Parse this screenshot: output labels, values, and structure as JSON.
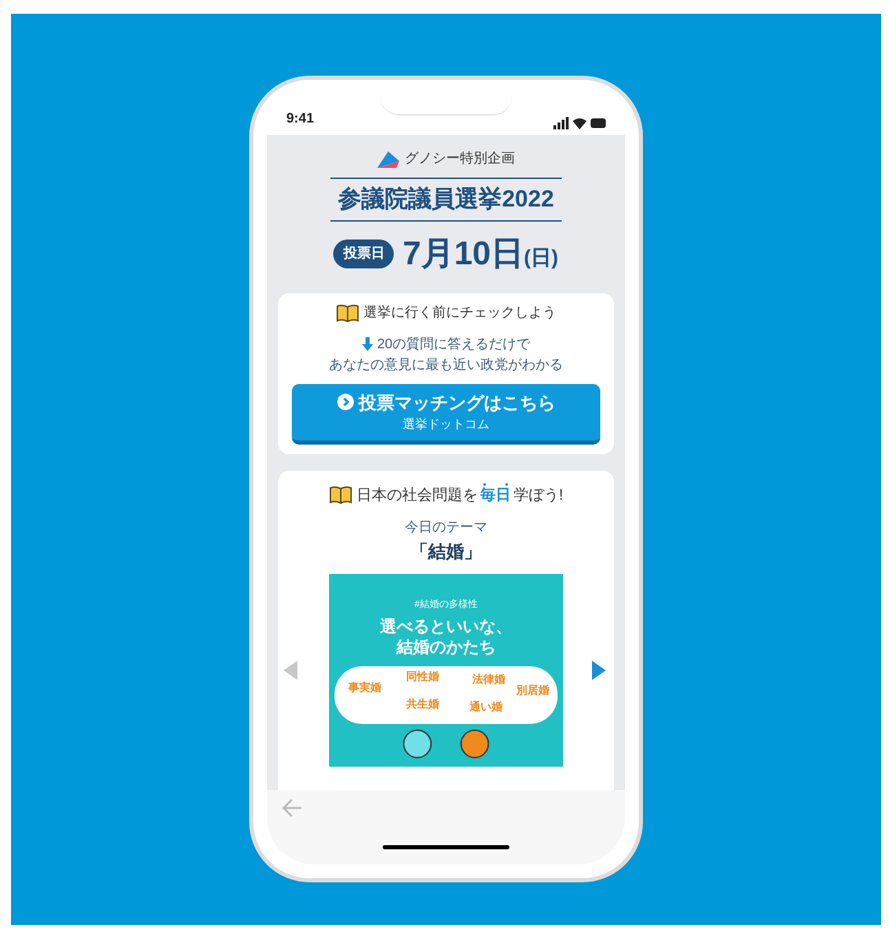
{
  "status_bar": {
    "time": "9:41"
  },
  "header": {
    "brand": "グノシー特別企画",
    "title": "参議院議員選挙2022",
    "date_badge": "投票日",
    "date_main": "7月10日",
    "date_suffix": "(日)"
  },
  "matching_card": {
    "heading": "選挙に行く前にチェックしよう",
    "lead_1": "20の質問に答えるだけで",
    "lead_2": "あなたの意見に最も近い政党がわかる",
    "button_label": "投票マッチングはこちら",
    "button_sub": "選挙ドットコム"
  },
  "learn_card": {
    "heading_before": "日本の社会問題を",
    "heading_emphasis": "毎日",
    "heading_after": "学ぼう!",
    "theme_label": "今日のテーマ",
    "theme": "「結婚」",
    "carousel": {
      "prev_disabled": true,
      "next_disabled": false,
      "slide": {
        "tag": "#結婚の多様性",
        "title_1": "選べるといいな、",
        "title_2": "結婚のかたち",
        "words": [
          "事実婚",
          "同性婚",
          "法律婚",
          "別居婚",
          "共生婚",
          "通い婚"
        ]
      }
    }
  }
}
